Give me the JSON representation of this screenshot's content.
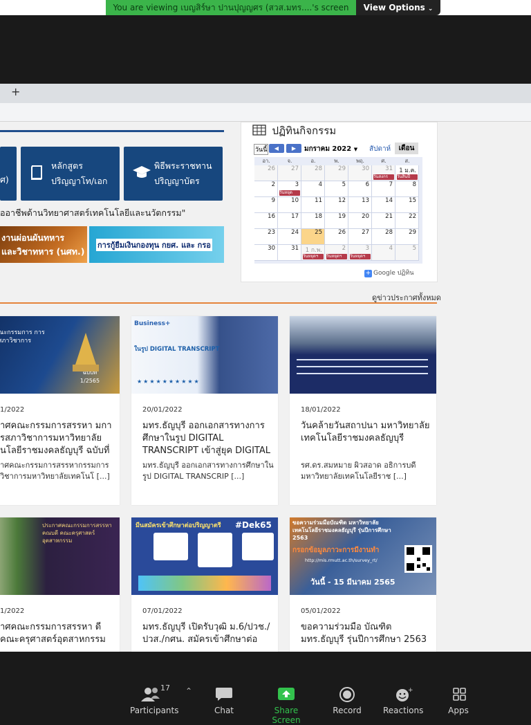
{
  "zoom": {
    "share_banner": "You are viewing เบญสิร์ษา ปานปุญญศร (สวส.มทร....'s screen",
    "view_options": "View Options",
    "toolbar": {
      "participants_label": "Participants",
      "participants_count": "17",
      "chat_label": "Chat",
      "share_label": "Share Screen",
      "record_label": "Record",
      "reactions_label": "Reactions",
      "apps_label": "Apps"
    }
  },
  "browser": {
    "new_tab": "+"
  },
  "site": {
    "tiles": [
      {
        "label": "ศ)"
      },
      {
        "label_line1": "หลักสูตร",
        "label_line2": "ปริญญาโท/เอก"
      },
      {
        "label_line1": "พิธีพระราชทาน",
        "label_line2": "ปริญญาบัตร"
      }
    ],
    "slogan": "ออาชีพด้านวิทยาศาสตร์เทคโนโลยีและนวัตกรรม\"",
    "banner1": {
      "line1": "งานผ่อนผันทหาร",
      "line2": "และวิชาทหาร (นศท.)"
    },
    "banner2": {
      "text": "การกู้ยืมเงินกองทุน กยศ. และ กรอ"
    },
    "calendar": {
      "title": "ปฏิทินกิจกรรม",
      "today_btn": "วันนี้",
      "prev": "◀",
      "next": "▶",
      "month": "มกราคม 2022",
      "week_btn": "สัปดาห์",
      "month_btn": "เดือน",
      "dow": [
        "อา.",
        "จ.",
        "อ.",
        "พ.",
        "พฤ.",
        "ศ.",
        "ส."
      ],
      "weeks": [
        [
          "26",
          "27",
          "28",
          "29",
          "30",
          "31",
          "1 ม.ค."
        ],
        [
          "2",
          "3",
          "4",
          "5",
          "6",
          "7",
          "8"
        ],
        [
          "9",
          "10",
          "11",
          "12",
          "13",
          "14",
          "15"
        ],
        [
          "16",
          "17",
          "18",
          "19",
          "20",
          "21",
          "22"
        ],
        [
          "23",
          "24",
          "25",
          "26",
          "27",
          "28",
          "29"
        ],
        [
          "30",
          "31",
          "1 ก.พ.",
          "2",
          "3",
          "4",
          "5"
        ]
      ],
      "events": [
        "วันสงกร",
        "วันสิ้นปี",
        "วันหยุด",
        "วันหยุดฯ",
        "วันหยุดฯ",
        "วันหยุดฯ"
      ],
      "google": "Google",
      "google_suffix": "ปฏิทิน"
    },
    "view_all": "ดูข่าวประกาศทั้งหมด",
    "cards": [
      {
        "img_text": "ณะกรรมการ การสภาวิชาการ",
        "img_badge": "ฉบับที่ 1/2565",
        "date": "1/2022",
        "title": "าศคณะกรรมการสรรหา มการสภาวิชาการมหาวิทยาลัย นโลยีราชมงคลธัญบุรี ฉบับที่",
        "excerpt": "าศคณะกรรมการสรรหากรรมการ วิชาการมหาวิทยาลัยเทคโนโ [...]"
      },
      {
        "img_text": "Business+",
        "img_sub": "ในรูป DIGITAL TRANSCRIPT",
        "date": "20/01/2022",
        "title": "มทร.ธัญบุรี ออกเอกสารทางการ ศึกษาในรูป DIGITAL TRANSCRIPT เข้าสู่ยุค DIGITAL",
        "excerpt": "มทร.ธัญบุรี ออกเอกสารทางการศึกษาใน รูป DIGITAL TRANSCRIP [...]"
      },
      {
        "date": "18/01/2022",
        "title": "วันคล้ายวันสถาปนา มหาวิทยาลัย เทคโนโลยีราชมงคลธัญบุรี",
        "excerpt": "รศ.ดร.สมหมาย ผิวสอาด อธิการบดี มหาวิทยาลัยเทคโนโลยีราช [...]"
      },
      {
        "img_text": "ประกาศคณะกรรมการสรรหาคณบดี คณะครุศาสตร์อุตสาหกรรม",
        "date": "1/2022",
        "title": "าศคณะกรรมการสรรหา ดีคณะครุศาสตร์อุตสาหกรรม",
        "excerpt": ""
      },
      {
        "img_text": "มีนสมัครเข้าศึกษาต่อปริญญาตรี",
        "img_badge": "#Dek65",
        "date": "07/01/2022",
        "title": "มทร.ธัญบุรี เปิดรับวุฒิ ม.6/ปวช./ ปวส./กศน. สมัครเข้าศึกษาต่อ",
        "excerpt": ""
      },
      {
        "img_text": "ขอความร่วมมือบัณฑิต มหาวิทยาลัยเทคโนโลยีราชมงคลธัญบุรี รุ่นปีการศึกษา 2563",
        "img_sub": "กรอกข้อมูลภาวะการมีงานทำ",
        "img_url": "http://mis.rmutt.ac.th/survey_rt/",
        "img_badge": "วันนี้ - 15 มีนาคม 2565",
        "date": "05/01/2022",
        "title": "ขอความร่วมมือ บัณฑิต มทร.ธัญบุรี รุ่นปีการศึกษา 2563",
        "excerpt": ""
      }
    ]
  },
  "colors": {
    "zoom_green": "#3bb44a",
    "site_blue": "#17477e",
    "accent_orange": "#e5833a",
    "calendar_event": "#b53a4a"
  }
}
